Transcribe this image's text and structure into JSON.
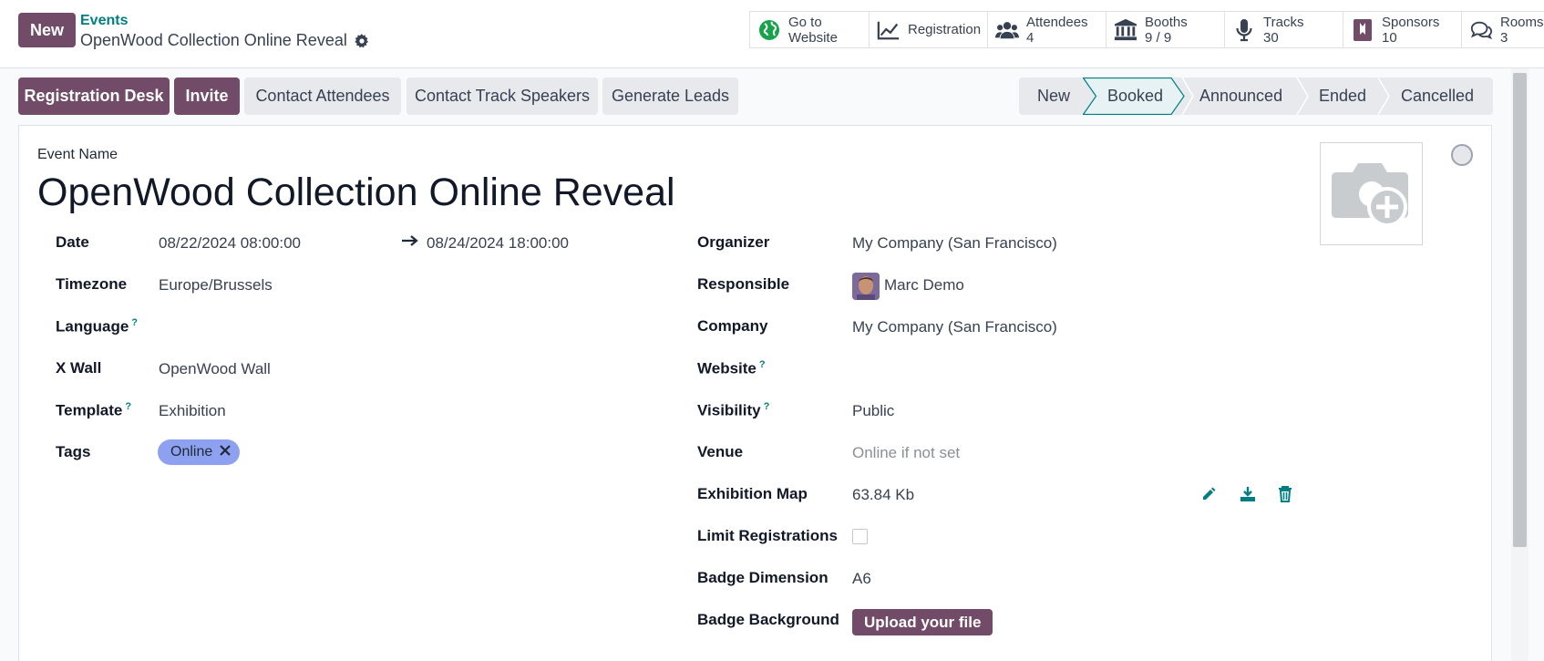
{
  "header": {
    "new_label": "New",
    "breadcrumb_parent": "Events",
    "breadcrumb_current": "OpenWood Collection Online Reveal"
  },
  "smart_buttons": [
    {
      "icon": "globe-icon",
      "label": "Go to",
      "value": "Website"
    },
    {
      "icon": "chart-line-icon",
      "label": "Registration",
      "value": ""
    },
    {
      "icon": "users-icon",
      "label": "Attendees",
      "value": "4"
    },
    {
      "icon": "bank-icon",
      "label": "Booths",
      "value": "9 / 9"
    },
    {
      "icon": "microphone-icon",
      "label": "Tracks",
      "value": "30"
    },
    {
      "icon": "ribbon-icon",
      "label": "Sponsors",
      "value": "10"
    },
    {
      "icon": "comments-icon",
      "label": "Rooms",
      "value": "3"
    }
  ],
  "actions": {
    "registration_desk": "Registration Desk",
    "invite": "Invite",
    "contact_attendees": "Contact Attendees",
    "contact_track_speakers": "Contact Track Speakers",
    "generate_leads": "Generate Leads"
  },
  "stages": [
    "New",
    "Booked",
    "Announced",
    "Ended",
    "Cancelled"
  ],
  "active_stage": "Booked",
  "form": {
    "event_name_label": "Event Name",
    "event_name": "OpenWood Collection Online Reveal",
    "left": {
      "date_label": "Date",
      "date_start": "08/22/2024 08:00:00",
      "date_end": "08/24/2024 18:00:00",
      "timezone_label": "Timezone",
      "timezone": "Europe/Brussels",
      "language_label": "Language",
      "xwall_label": "X Wall",
      "xwall": "OpenWood Wall",
      "template_label": "Template",
      "template": "Exhibition",
      "tags_label": "Tags",
      "tag": "Online"
    },
    "right": {
      "organizer_label": "Organizer",
      "organizer": "My Company (San Francisco)",
      "responsible_label": "Responsible",
      "responsible": "Marc Demo",
      "company_label": "Company",
      "company": "My Company (San Francisco)",
      "website_label": "Website",
      "visibility_label": "Visibility",
      "visibility": "Public",
      "venue_label": "Venue",
      "venue_placeholder": "Online if not set",
      "exhibition_map_label": "Exhibition Map",
      "exhibition_map": "63.84 Kb",
      "limit_registrations_label": "Limit Registrations",
      "badge_dimension_label": "Badge Dimension",
      "badge_dimension": "A6",
      "badge_background_label": "Badge Background",
      "upload_label": "Upload your file"
    },
    "help_mark": "?"
  },
  "colors": {
    "primary": "#714b67",
    "accent": "#017e84",
    "tag": "#8ea1f0"
  }
}
